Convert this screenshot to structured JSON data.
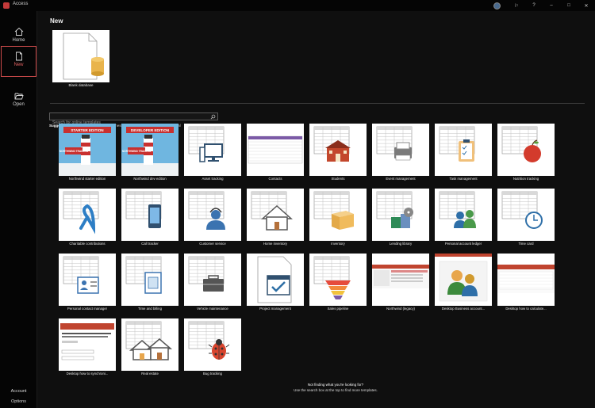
{
  "window": {
    "title": "Access"
  },
  "sidebar": {
    "home": "Home",
    "new": "New",
    "open": "Open",
    "account": "Account",
    "options": "Options"
  },
  "main": {
    "heading": "New",
    "blank": {
      "label": "Blank database"
    },
    "search": {
      "placeholder": "Search for online templates"
    },
    "suggested": {
      "label": "Suggested searches:",
      "items": [
        "Database",
        "Business",
        "Logs",
        "Industry",
        "Lists",
        "Personal",
        "Contacts"
      ]
    },
    "templates": [
      "Northwind starter edition",
      "Northwind dev edition",
      "Asset tracking",
      "Contacts",
      "Students",
      "Event management",
      "Task management",
      "Nutrition tracking",
      "Charitable contributions",
      "Call tracker",
      "Customer service",
      "Home inventory",
      "Inventory",
      "Lending library",
      "Personal account ledger",
      "Time card",
      "Personal contact manager",
      "Time and billing",
      "Vehicle maintenance",
      "Project management",
      "Sales pipeline",
      "Northwind (legacy)",
      "Desktop Business account...",
      "Desktop how to calculate...",
      "Desktop how to synchroni...",
      "Real estate",
      "Bug tracking"
    ],
    "badges": {
      "starter": "STARTER EDITION",
      "developer": "DEVELOPER EDITION",
      "traders": "NORTHWIND TRADERS"
    },
    "footer": {
      "line1": "Not finding what you're looking for?",
      "line2": "Use the search box at the top to find more templates."
    }
  }
}
